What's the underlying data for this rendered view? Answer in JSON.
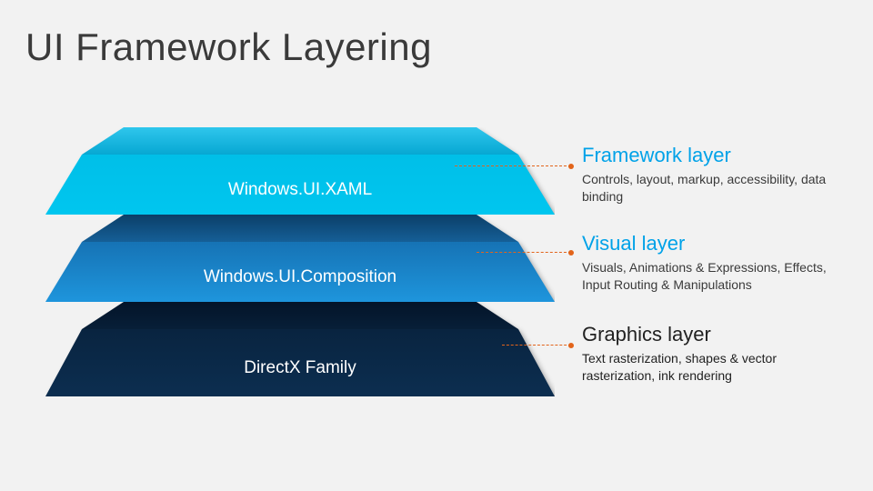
{
  "title": "UI Framework Layering",
  "colors": {
    "accent": "#00a2e8",
    "leader": "#e2641a"
  },
  "layers": [
    {
      "label": "Windows.UI.XAML",
      "desc_title": "Framework layer",
      "desc_body": "Controls, layout, markup, accessibility, data binding",
      "fill_top": "#00b2e0",
      "fill_main": "#00bfe8"
    },
    {
      "label": "Windows.UI.Composition",
      "desc_title": "Visual layer",
      "desc_body": "Visuals, Animations & Expressions, Effects, Input Routing & Manipulations",
      "fill_top": "#0b3e66",
      "fill_main": "#1a8ed4"
    },
    {
      "label": "DirectX Family",
      "desc_title": "Graphics layer",
      "desc_body": "Text rasterization, shapes & vector rasterization, ink rendering",
      "fill_top": "#031327",
      "fill_main": "#0a2744"
    }
  ]
}
